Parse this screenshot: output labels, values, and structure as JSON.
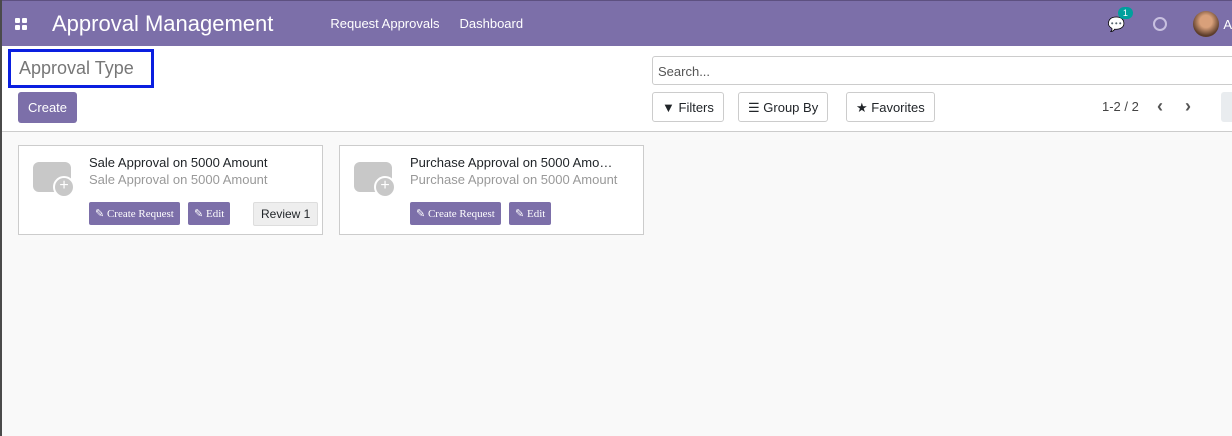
{
  "navbar": {
    "app_title": "Approval Management",
    "menu": [
      "Request Approvals",
      "Dashboard"
    ],
    "message_count": "1",
    "user_initial": "A"
  },
  "control_panel": {
    "breadcrumb": "Approval Type",
    "create_label": "Create",
    "search_placeholder": "Search...",
    "filters_label": "Filters",
    "group_by_label": "Group By",
    "favorites_label": "Favorites",
    "pager": "1-2 / 2"
  },
  "cards": [
    {
      "title": "Sale Approval on 5000 Amount",
      "subtitle": "Sale Approval on 5000 Amount",
      "create_request": "Create Request",
      "edit": "Edit",
      "review": "Review 1"
    },
    {
      "title": "Purchase Approval on 5000 Amo…",
      "subtitle": "Purchase Approval on 5000 Amount",
      "create_request": "Create Request",
      "edit": "Edit"
    }
  ]
}
